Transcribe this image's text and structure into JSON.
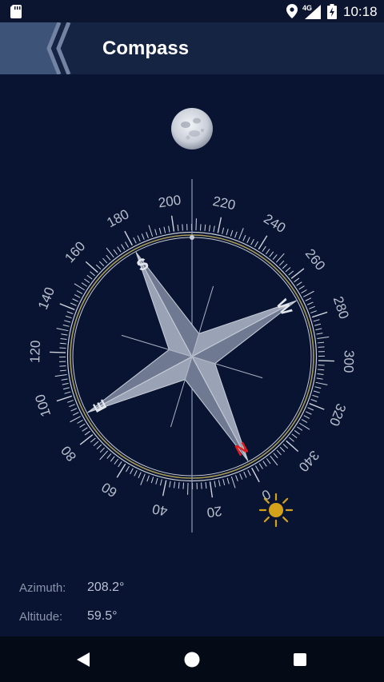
{
  "status_bar": {
    "time": "10:18",
    "network": "4G"
  },
  "header": {
    "title": "Compass"
  },
  "compass": {
    "heading_deg": 208.2,
    "dial_labels": [
      "0",
      "20",
      "40",
      "60",
      "80",
      "100",
      "120",
      "140",
      "160",
      "180",
      "200",
      "220",
      "240",
      "260",
      "280",
      "300",
      "320",
      "340"
    ],
    "cardinals": [
      "N",
      "E",
      "S",
      "W"
    ],
    "colors": {
      "north": "#e21b1b",
      "sun": "#d4a21a",
      "ring_accent": "#a89a55"
    }
  },
  "readouts": {
    "azimuth_label": "Azimuth:",
    "azimuth_value": "208.2°",
    "altitude_label": "Altitude:",
    "altitude_value": "59.5°"
  },
  "icons": [
    "sd-card-icon",
    "location-icon",
    "signal-icon",
    "battery-icon",
    "back-chevron-icon",
    "moon-icon",
    "sun-icon",
    "nav-back-icon",
    "nav-home-icon",
    "nav-recents-icon"
  ]
}
